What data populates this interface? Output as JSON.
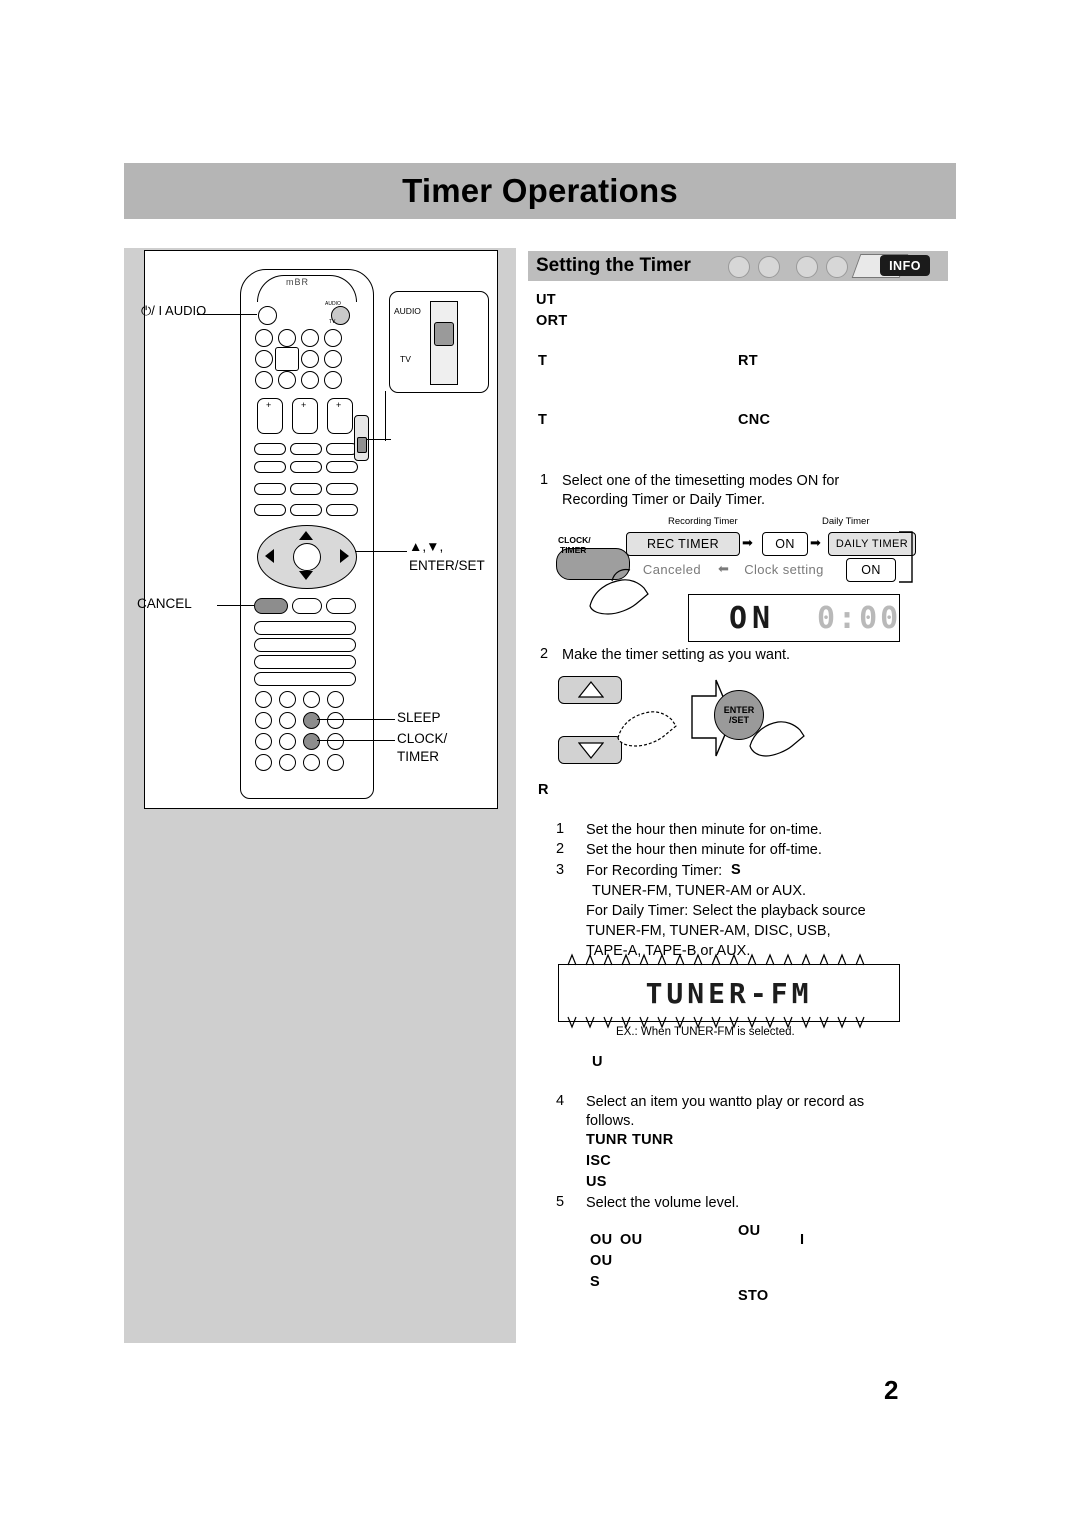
{
  "page": {
    "title": "Timer Operations",
    "page_number": "2"
  },
  "section": {
    "heading": "Setting the Timer",
    "info_badge": "INFO"
  },
  "notes": {
    "line1": "UT",
    "line2": "ORT",
    "line3_left": "T",
    "line3_right": "RT",
    "line4_left": "T",
    "line4_right": "CNC"
  },
  "steps": {
    "step1_num": "1",
    "step1_text_a": "Select one of the time",
    "step1_text_b": "setting modes ON for",
    "step1_text_c": "Recording Timer or Daily Timer.",
    "step2_num": "2",
    "step2_text": "Make the timer setting as you want.",
    "step_r_label": "R"
  },
  "diagram1": {
    "caption_rec": "Recording Timer",
    "caption_daily": "Daily Timer",
    "clock_label_1": "CLOCK/",
    "clock_label_2": "TIMER",
    "pill_rec": "REC TIMER",
    "pill_rec_on": "ON",
    "pill_daily": "DAILY TIMER",
    "pill_daily_on": "ON",
    "pill_canceled": "Canceled",
    "pill_clock_setting": "Clock setting",
    "arrow_right": "➡",
    "arrow_left": "⬅",
    "lcd_main": "ON",
    "lcd_ghost": "0:00"
  },
  "diagram2": {
    "enter_line1": "ENTER",
    "enter_line2": "/SET"
  },
  "substeps": [
    {
      "num": "1",
      "text": "Set the hour then minute for on-time."
    },
    {
      "num": "2",
      "text": "Set the hour then minute for off-time."
    },
    {
      "num": "3",
      "text": "For Recording Timer:"
    },
    {
      "num": "4",
      "text": "Select an item you want"
    },
    {
      "num": "5",
      "text": "Select the volume level."
    }
  ],
  "substep3": {
    "bold_tail": "S",
    "sources_rec": "TUNER-FM,  TUNER-AM  or  AUX.",
    "daily_intro": "For Daily Timer: Select the playback source",
    "sources_daily_1": "TUNER-FM,  TUNER-AM,  DISC,  USB,",
    "sources_daily_2": "TAPE-A,  TAPE-B  or  AUX."
  },
  "substep4": {
    "text_a": "Select an item you want",
    "text_b": "to play or record as",
    "text_c": "follows.",
    "bold1": "TUNR",
    "bold2": "TUNR",
    "bold3": "ISC",
    "bold4": "US"
  },
  "substep5": {
    "bold_right_top": "OU",
    "bold1": "OU",
    "bold2": "OU",
    "bold_far_right": "I",
    "bold3": "OU",
    "bold4": "S",
    "bold5": "STO"
  },
  "tuner_lcd": {
    "text": "TUNER-FM",
    "caption": "EX.: When TUNER-FM is selected.",
    "u_label": "U"
  },
  "remote": {
    "brand": "mBR",
    "label_power": "/ I  AUDIO",
    "label_power_glyph": "⏻",
    "label_nav": "▲,▼,",
    "label_enter": "ENTER/SET",
    "label_cancel": "CANCEL",
    "label_sleep": "SLEEP",
    "label_clock_1": "CLOCK/",
    "label_clock_2": "TIMER",
    "inset_audio": "AUDIO",
    "inset_tv": "TV",
    "badge_audio": "AUDIO",
    "badge_tv": "TV"
  }
}
